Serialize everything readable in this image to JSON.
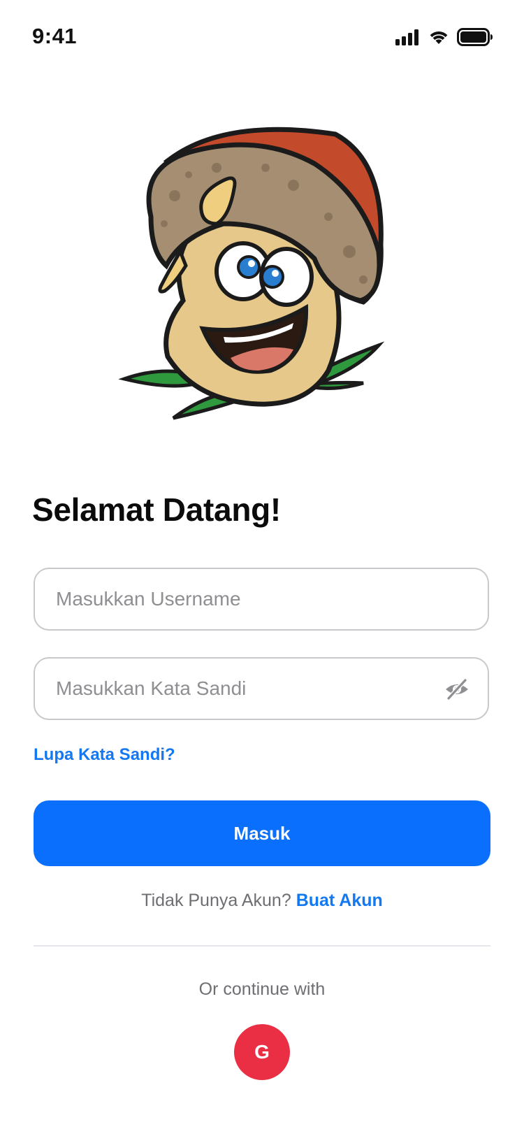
{
  "status_bar": {
    "time": "9:41"
  },
  "welcome": {
    "title": "Selamat Datang!"
  },
  "form": {
    "username_placeholder": "Masukkan Username",
    "username_value": "",
    "password_placeholder": "Masukkan Kata Sandi",
    "password_value": "",
    "password_toggle_icon": "eye-slash-icon",
    "forgot_label": "Lupa Kata Sandi?",
    "submit_label": "Masuk"
  },
  "signup": {
    "prompt": "Tidak Punya Akun?",
    "link_label": "Buat Akun"
  },
  "social": {
    "label": "Or continue with",
    "google_letter": "G"
  },
  "colors": {
    "primary": "#0a6ffc",
    "link": "#1478f0",
    "google": "#ea2f45"
  }
}
